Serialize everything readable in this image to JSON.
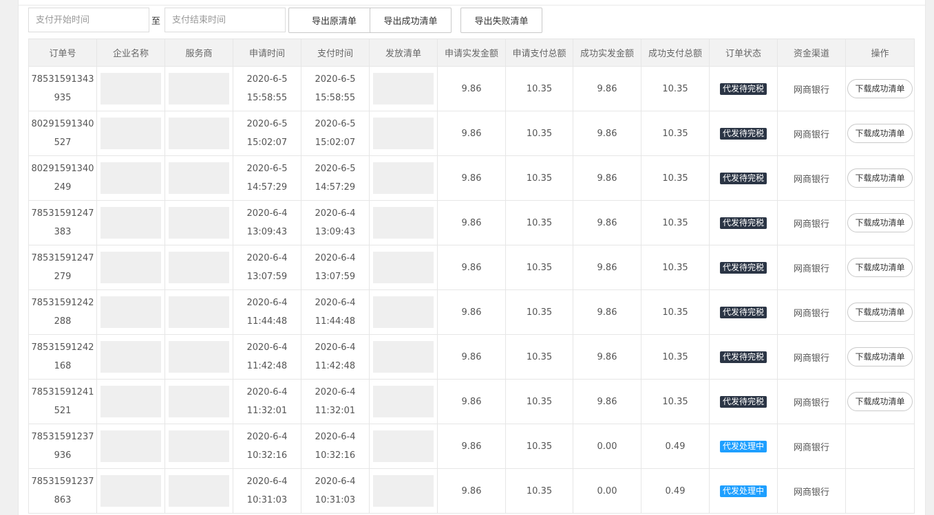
{
  "filters": {
    "start_placeholder": "支付开始时间",
    "separator": "至",
    "end_placeholder": "支付结束时间",
    "export_raw_label": "导出原清单",
    "export_success_label": "导出成功清单",
    "export_fail_label": "导出失败清单"
  },
  "table": {
    "columns": [
      "订单号",
      "企业名称",
      "服务商",
      "申请时间",
      "支付时间",
      "发放清单",
      "申请实发金额",
      "申请支付总额",
      "成功实发金额",
      "成功支付总额",
      "订单状态",
      "资金渠道",
      "操作"
    ],
    "rows": [
      {
        "order_id": "78531591343935",
        "apply_date": "2020-6-5",
        "apply_time": "15:58:55",
        "pay_date": "2020-6-5",
        "pay_time": "15:58:55",
        "apply_actual": "9.86",
        "apply_total": "10.35",
        "success_actual": "9.86",
        "success_total": "10.35",
        "status": "代发待完税",
        "status_color": "#2b3545",
        "channel": "网商银行",
        "action": "下载成功清单"
      },
      {
        "order_id": "80291591340527",
        "apply_date": "2020-6-5",
        "apply_time": "15:02:07",
        "pay_date": "2020-6-5",
        "pay_time": "15:02:07",
        "apply_actual": "9.86",
        "apply_total": "10.35",
        "success_actual": "9.86",
        "success_total": "10.35",
        "status": "代发待完税",
        "status_color": "#2b3545",
        "channel": "网商银行",
        "action": "下载成功清单"
      },
      {
        "order_id": "80291591340249",
        "apply_date": "2020-6-5",
        "apply_time": "14:57:29",
        "pay_date": "2020-6-5",
        "pay_time": "14:57:29",
        "apply_actual": "9.86",
        "apply_total": "10.35",
        "success_actual": "9.86",
        "success_total": "10.35",
        "status": "代发待完税",
        "status_color": "#2b3545",
        "channel": "网商银行",
        "action": "下载成功清单"
      },
      {
        "order_id": "78531591247383",
        "apply_date": "2020-6-4",
        "apply_time": "13:09:43",
        "pay_date": "2020-6-4",
        "pay_time": "13:09:43",
        "apply_actual": "9.86",
        "apply_total": "10.35",
        "success_actual": "9.86",
        "success_total": "10.35",
        "status": "代发待完税",
        "status_color": "#2b3545",
        "channel": "网商银行",
        "action": "下载成功清单"
      },
      {
        "order_id": "78531591247279",
        "apply_date": "2020-6-4",
        "apply_time": "13:07:59",
        "pay_date": "2020-6-4",
        "pay_time": "13:07:59",
        "apply_actual": "9.86",
        "apply_total": "10.35",
        "success_actual": "9.86",
        "success_total": "10.35",
        "status": "代发待完税",
        "status_color": "#2b3545",
        "channel": "网商银行",
        "action": "下载成功清单"
      },
      {
        "order_id": "78531591242288",
        "apply_date": "2020-6-4",
        "apply_time": "11:44:48",
        "pay_date": "2020-6-4",
        "pay_time": "11:44:48",
        "apply_actual": "9.86",
        "apply_total": "10.35",
        "success_actual": "9.86",
        "success_total": "10.35",
        "status": "代发待完税",
        "status_color": "#2b3545",
        "channel": "网商银行",
        "action": "下载成功清单"
      },
      {
        "order_id": "78531591242168",
        "apply_date": "2020-6-4",
        "apply_time": "11:42:48",
        "pay_date": "2020-6-4",
        "pay_time": "11:42:48",
        "apply_actual": "9.86",
        "apply_total": "10.35",
        "success_actual": "9.86",
        "success_total": "10.35",
        "status": "代发待完税",
        "status_color": "#2b3545",
        "channel": "网商银行",
        "action": "下载成功清单"
      },
      {
        "order_id": "78531591241521",
        "apply_date": "2020-6-4",
        "apply_time": "11:32:01",
        "pay_date": "2020-6-4",
        "pay_time": "11:32:01",
        "apply_actual": "9.86",
        "apply_total": "10.35",
        "success_actual": "9.86",
        "success_total": "10.35",
        "status": "代发待完税",
        "status_color": "#2b3545",
        "channel": "网商银行",
        "action": "下载成功清单"
      },
      {
        "order_id": "78531591237936",
        "apply_date": "2020-6-4",
        "apply_time": "10:32:16",
        "pay_date": "2020-6-4",
        "pay_time": "10:32:16",
        "apply_actual": "9.86",
        "apply_total": "10.35",
        "success_actual": "0.00",
        "success_total": "0.49",
        "status": "代发处理中",
        "status_color": "#1e9fff",
        "channel": "网商银行",
        "action": ""
      },
      {
        "order_id": "78531591237863",
        "apply_date": "2020-6-4",
        "apply_time": "10:31:03",
        "pay_date": "2020-6-4",
        "pay_time": "10:31:03",
        "apply_actual": "9.86",
        "apply_total": "10.35",
        "success_actual": "0.00",
        "success_total": "0.49",
        "status": "代发处理中",
        "status_color": "#1e9fff",
        "channel": "网商银行",
        "action": ""
      }
    ]
  }
}
